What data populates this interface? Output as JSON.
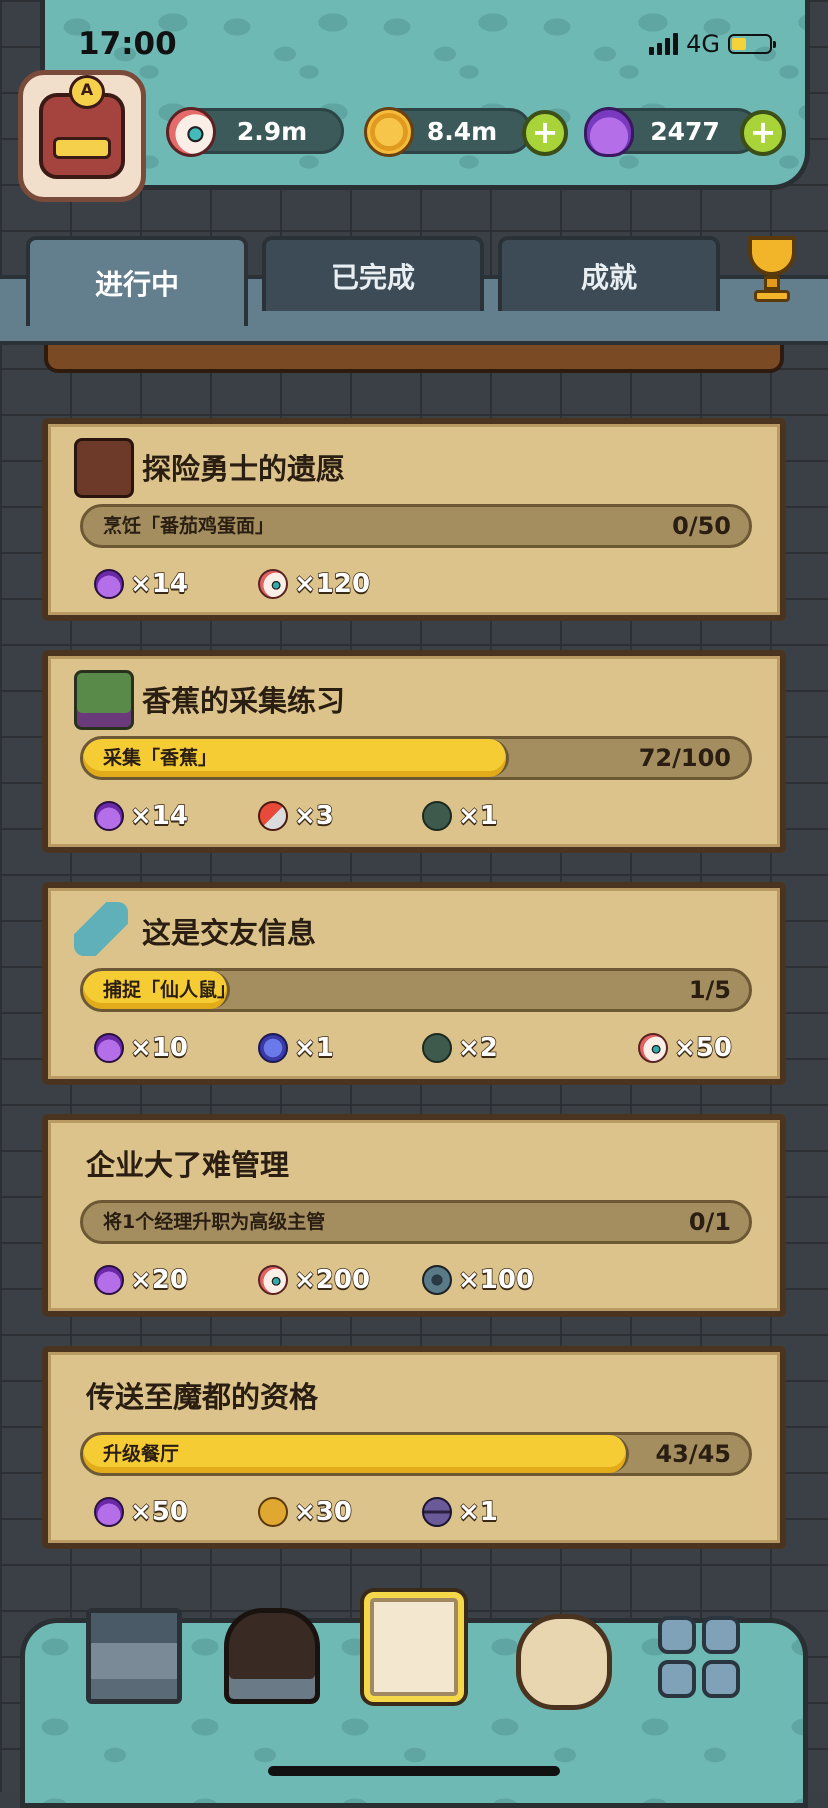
{
  "status_bar": {
    "time": "17:00",
    "network": "4G"
  },
  "resources": [
    {
      "icon": "eyeball-icon",
      "value": "2.9m"
    },
    {
      "icon": "coin-icon",
      "value": "8.4m"
    },
    {
      "icon": "potion-icon",
      "value": "2477"
    }
  ],
  "avatar": {
    "badge_letter": "A"
  },
  "tabs": [
    {
      "label": "进行中",
      "active": true
    },
    {
      "label": "已完成",
      "active": false
    },
    {
      "label": "成就",
      "active": false
    }
  ],
  "quests": [
    {
      "title": "探险勇士的遗愿",
      "icon": "book-icon",
      "task": "烹饪「番茄鸡蛋面」",
      "progress": "0/50",
      "progress_fraction": 0.0,
      "rewards": [
        {
          "icon": "potion-icon",
          "amount": "×14"
        },
        {
          "icon": "eyeball-icon",
          "amount": "×120"
        }
      ]
    },
    {
      "title": "香蕉的采集练习",
      "icon": "chest-icon",
      "task": "采集「香蕉」",
      "progress": "72/100",
      "progress_fraction": 0.72,
      "rewards": [
        {
          "icon": "potion-icon",
          "amount": "×14"
        },
        {
          "icon": "magnet-icon",
          "amount": "×3"
        },
        {
          "icon": "card-icon",
          "amount": "×1"
        }
      ]
    },
    {
      "title": "这是交友信息",
      "icon": "bottle-icon",
      "task": "捕捉「仙人鼠」",
      "progress": "1/5",
      "progress_fraction": 0.2,
      "rewards": [
        {
          "icon": "potion-icon",
          "amount": "×10"
        },
        {
          "icon": "crystal-icon",
          "amount": "×1"
        },
        {
          "icon": "card-icon",
          "amount": "×2"
        },
        {
          "icon": "eyeball-icon",
          "amount": "×50"
        }
      ]
    },
    {
      "title": "企业大了难管理",
      "icon": "",
      "task": "将1个经理升职为高级主管",
      "progress": "0/1",
      "progress_fraction": 0.0,
      "rewards": [
        {
          "icon": "potion-icon",
          "amount": "×20"
        },
        {
          "icon": "eyeball-icon",
          "amount": "×200"
        },
        {
          "icon": "gear-icon",
          "amount": "×100"
        }
      ]
    },
    {
      "title": "传送至魔都的资格",
      "icon": "",
      "task": "升级餐厅",
      "progress": "43/45",
      "progress_fraction": 0.955,
      "rewards": [
        {
          "icon": "potion-icon",
          "amount": "×50"
        },
        {
          "icon": "gem-icon",
          "amount": "×30"
        },
        {
          "icon": "hourglass-icon",
          "amount": "×1"
        }
      ]
    }
  ],
  "bottom_nav": [
    {
      "name": "shop-icon"
    },
    {
      "name": "monster-icon"
    },
    {
      "name": "quest-book-icon",
      "active": true
    },
    {
      "name": "money-bag-icon"
    },
    {
      "name": "grid-menu-icon"
    }
  ]
}
